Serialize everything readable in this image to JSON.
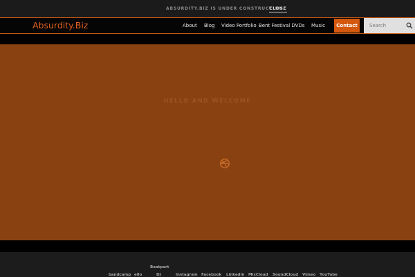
{
  "notice": {
    "text": "Absurdity.biz is under construction.",
    "close_label": "Close"
  },
  "header": {
    "logo": "Absurdity.Biz",
    "nav": [
      "About",
      "Blog",
      "Video Portfolio",
      "Bent Festival DVDs",
      "Music"
    ],
    "contact_label": "Contact",
    "search_placeholder": "Search"
  },
  "hero": {
    "title": "Hello and Welcome",
    "icon": "dribbble-ball-icon"
  },
  "footer": {
    "links": [
      "bandcamp",
      "ello",
      "Beatport",
      "DJ",
      "Instagram",
      "Facebook",
      "LinkedIn",
      "MixCloud",
      "SoundCloud",
      "Vimeo",
      "YouTube"
    ]
  },
  "colors": {
    "accent": "#d4590f",
    "hero_bg": "#8a4111",
    "logo": "#e1621b"
  }
}
